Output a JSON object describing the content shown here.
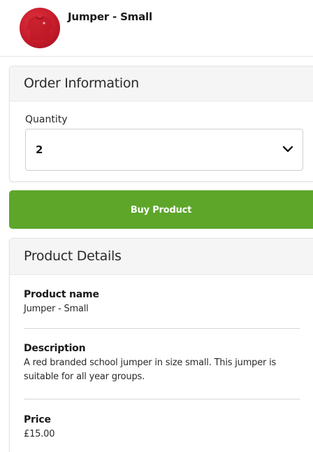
{
  "header": {
    "title": "Jumper - Small"
  },
  "order": {
    "title": "Order Information",
    "quantity_label": "Quantity",
    "quantity_value": "2"
  },
  "buy_button_label": "Buy Product",
  "details": {
    "title": "Product Details",
    "name_label": "Product name",
    "name_value": "Jumper - Small",
    "description_label": "Description",
    "description_value": "A red branded school jumper in size small. This jumper is suitable for all year groups.",
    "price_label": "Price",
    "price_value": "£15.00"
  },
  "colors": {
    "accent_green": "#5da62a",
    "product_red": "#c41b2a"
  }
}
